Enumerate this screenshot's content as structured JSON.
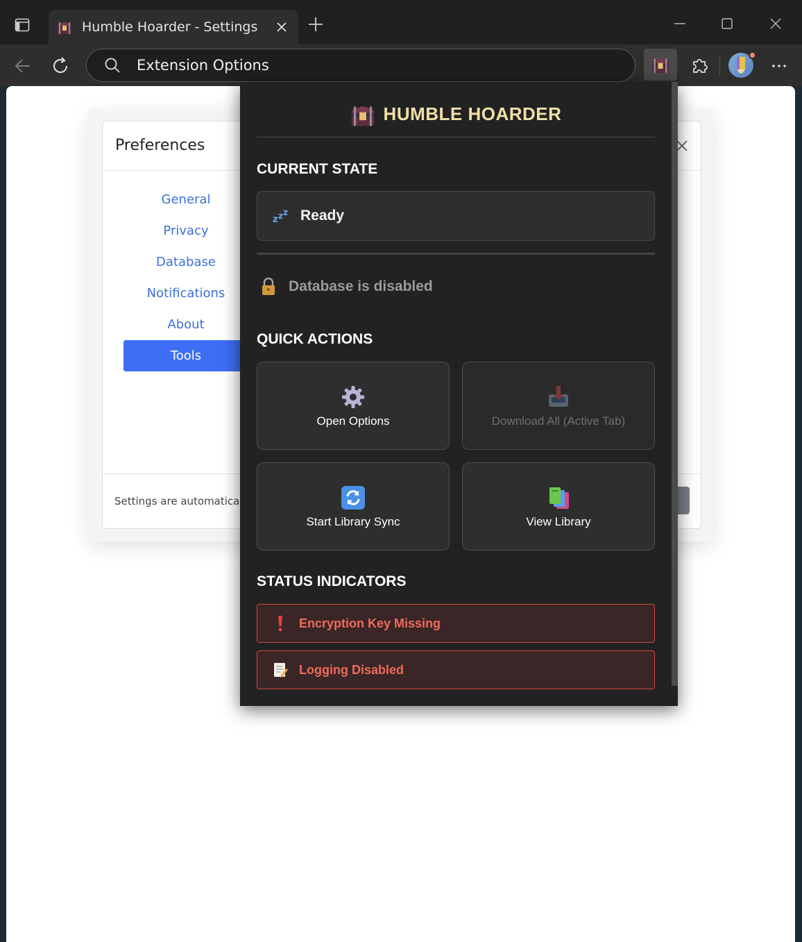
{
  "browser": {
    "tab_title": "Humble Hoarder - Settings",
    "address": "Extension Options",
    "icons": {
      "sidebar_toggle": "sidebar-icon",
      "new_tab": "plus-icon",
      "back": "arrow-left-icon",
      "reload": "reload-icon",
      "search": "search-icon",
      "extensions": "puzzle-icon",
      "more": "ellipsis-icon"
    }
  },
  "preferences": {
    "title": "Preferences",
    "nav": [
      {
        "label": "General",
        "active": false
      },
      {
        "label": "Privacy",
        "active": false
      },
      {
        "label": "Database",
        "active": false
      },
      {
        "label": "Notifications",
        "active": false
      },
      {
        "label": "About",
        "active": false
      },
      {
        "label": "Tools",
        "active": true
      }
    ],
    "footer_text": "Settings are automatically"
  },
  "popup": {
    "title": "HUMBLE HOARDER",
    "current_state_label": "CURRENT STATE",
    "state": "Ready",
    "database_status": "Database is disabled",
    "quick_actions_label": "QUICK ACTIONS",
    "actions": [
      {
        "label": "Open Options",
        "icon": "gear-icon",
        "disabled": false
      },
      {
        "label": "Download All (Active Tab)",
        "icon": "download-tray-icon",
        "disabled": true
      },
      {
        "label": "Start Library Sync",
        "icon": "sync-icon",
        "disabled": false
      },
      {
        "label": "View Library",
        "icon": "books-icon",
        "disabled": false
      }
    ],
    "status_indicators_label": "STATUS INDICATORS",
    "indicators": [
      {
        "label": "Encryption Key Missing",
        "icon": "exclamation-icon"
      },
      {
        "label": "Logging Disabled",
        "icon": "memo-icon"
      }
    ]
  },
  "colors": {
    "popup_bg": "#222222",
    "title_gold": "#f0e0a8",
    "error_red": "#ef6a5a",
    "accent_blue": "#3d6ef5"
  }
}
